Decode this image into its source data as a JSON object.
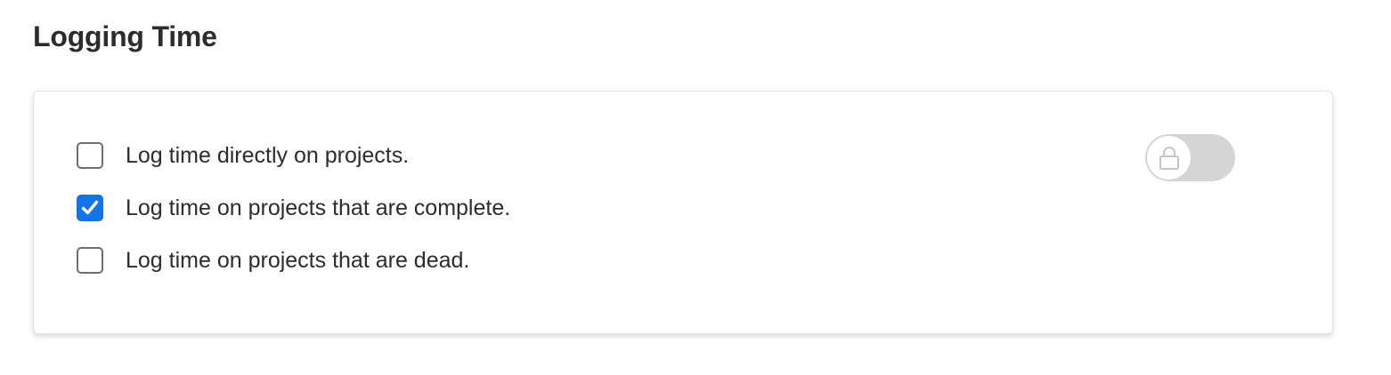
{
  "section": {
    "title": "Logging Time"
  },
  "options": [
    {
      "label": "Log time directly on projects.",
      "checked": false
    },
    {
      "label": "Log time on projects that are complete.",
      "checked": true
    },
    {
      "label": "Log time on projects that are dead.",
      "checked": false
    }
  ],
  "lock_toggle": {
    "state": "off",
    "locked": true,
    "icon": "lock-icon"
  },
  "colors": {
    "accent": "#1473e6",
    "text": "#2c2c2c",
    "checkbox_border": "#6e6e6e",
    "toggle_track": "#d5d5d5"
  }
}
